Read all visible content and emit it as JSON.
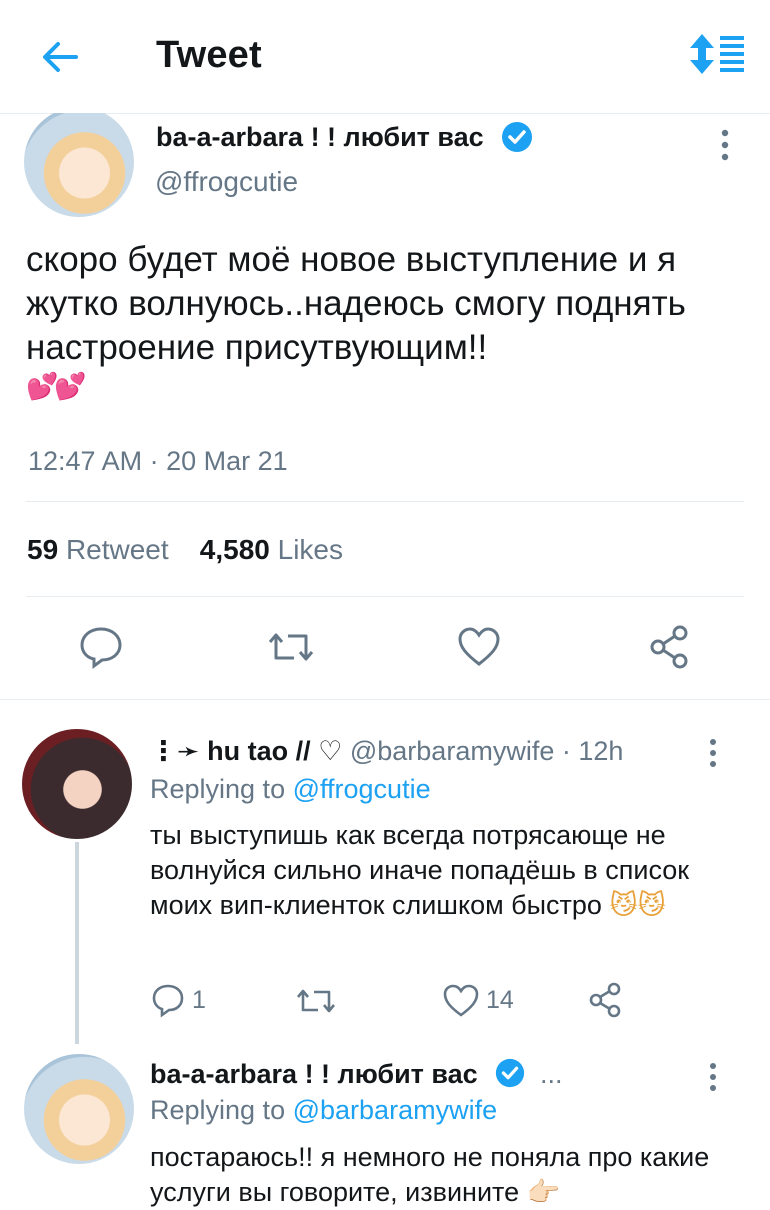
{
  "header": {
    "title": "Tweet"
  },
  "tweet": {
    "author_name": "ba-a-arbara ! ! любит вас",
    "author_handle": "@ffrogcutie",
    "text": "скоро будет моё новое выступление и я жутко волнуюсь..надеюсь смогу поднять настроение присутвующим!!",
    "emoji": "💕💕",
    "timestamp": "12:47 AM · 20 Mar 21",
    "retweet_count": "59",
    "retweet_label": "Retweet",
    "like_count": "4,580",
    "like_label": "Likes"
  },
  "replies": [
    {
      "author_prefix": "⋮➛",
      "author_name": "hu tao // ♡",
      "author_handle": "@barbaramywife",
      "age": "· 12h",
      "replying_to_label": "Replying to",
      "replying_to_handle": "@ffrogcutie",
      "text": "ты выступишь как всегда потрясающе не волнуйся сильно иначе попадёшь в список моих вип-клиенток слишком быстро",
      "emoji": "😼😼",
      "reply_count": "1",
      "like_count": "14"
    },
    {
      "author_name": "ba-a-arbara ! ! любит вас",
      "name_overflow": "...",
      "replying_to_label": "Replying to",
      "replying_to_handle": "@barbaramywife",
      "text": "постараюсь!! я немного не поняла про какие услуги вы говорите, извините 👉🏻"
    }
  ],
  "colors": {
    "accent": "#1da1f2",
    "muted": "#657786",
    "divider": "#e6ecf0",
    "text": "#14171a"
  }
}
